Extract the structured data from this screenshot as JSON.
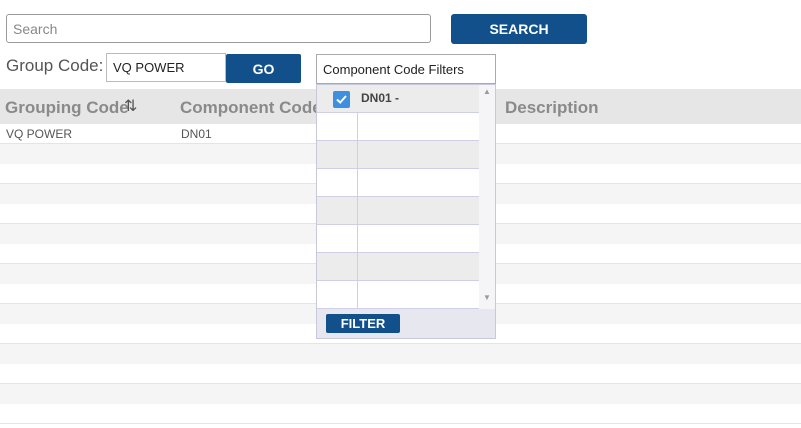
{
  "search": {
    "placeholder": "Search",
    "value": "",
    "button_label": "SEARCH"
  },
  "group_code": {
    "label": "Group Code:",
    "value": "VQ POWER",
    "go_label": "GO"
  },
  "component_filter": {
    "label": "Component Code Filters",
    "items": [
      {
        "label": "DN01 -",
        "checked": true
      }
    ],
    "filter_label": "FILTER"
  },
  "table": {
    "columns": [
      "Grouping Code",
      "Component Code",
      "Description"
    ],
    "sort_column": "Grouping Code",
    "rows": [
      {
        "grouping_code": "VQ POWER",
        "component_code": "DN01",
        "description": ""
      }
    ]
  },
  "colors": {
    "button_bg": "#12508c",
    "header_bg": "#e6e6e6",
    "alt_row_bg": "#f5f5f5",
    "checkbox_bg": "#3f8fe0"
  }
}
